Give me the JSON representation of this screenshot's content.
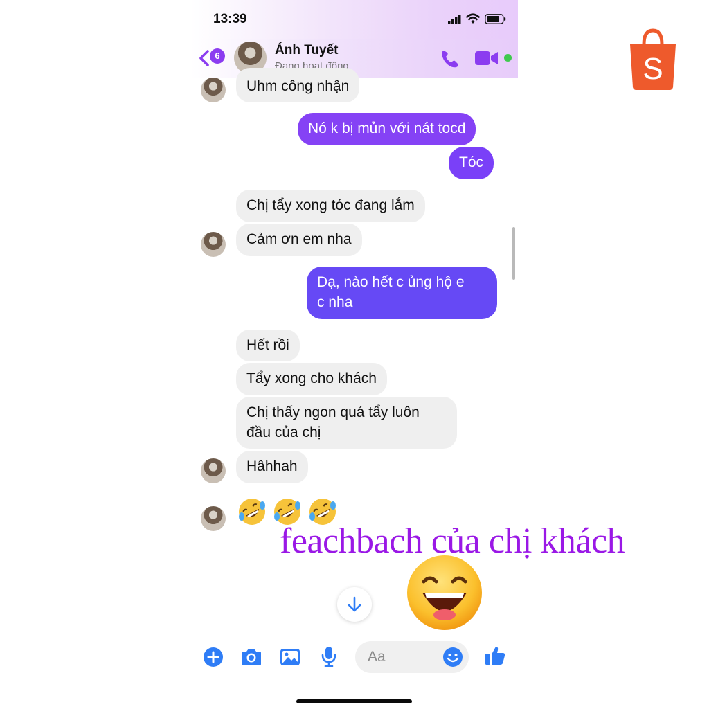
{
  "status_bar": {
    "time": "13:39"
  },
  "header": {
    "back_badge": "6",
    "contact_name": "Ánh Tuyết",
    "contact_status": "Đang hoạt động",
    "accent_color": "#8b3cf0",
    "online_color": "#3fc94e"
  },
  "messages": [
    {
      "side": "in",
      "text": "Uhm công nhận"
    },
    {
      "side": "out",
      "text": "Nó k bị mủn với nát tocd"
    },
    {
      "side": "out",
      "text": "Tóc"
    },
    {
      "side": "in",
      "text": "Chị tẩy xong tóc đang lắm"
    },
    {
      "side": "in",
      "text": "Cảm ơn em nha"
    },
    {
      "side": "out",
      "line1": "Dạ, nào hết c ủng hộ e",
      "line2": "c nha"
    },
    {
      "side": "in",
      "text": "Hết rồi"
    },
    {
      "side": "in",
      "text": "Tẩy xong cho khách"
    },
    {
      "side": "in",
      "line1": "Chị thấy ngon quá tẩy luôn",
      "line2": "đầu của chị"
    },
    {
      "side": "in",
      "text": "Hâhhah"
    },
    {
      "side": "in",
      "emoji": [
        "rolling-on-floor-laughing",
        "rolling-on-floor-laughing",
        "rolling-on-floor-laughing"
      ]
    }
  ],
  "composer": {
    "placeholder": "Aa"
  },
  "overlay": {
    "caption": "feachbach của chị khách",
    "caption_color": "#9a18e6",
    "shopee_letter": "S",
    "shopee_color": "#ee5a2c"
  }
}
